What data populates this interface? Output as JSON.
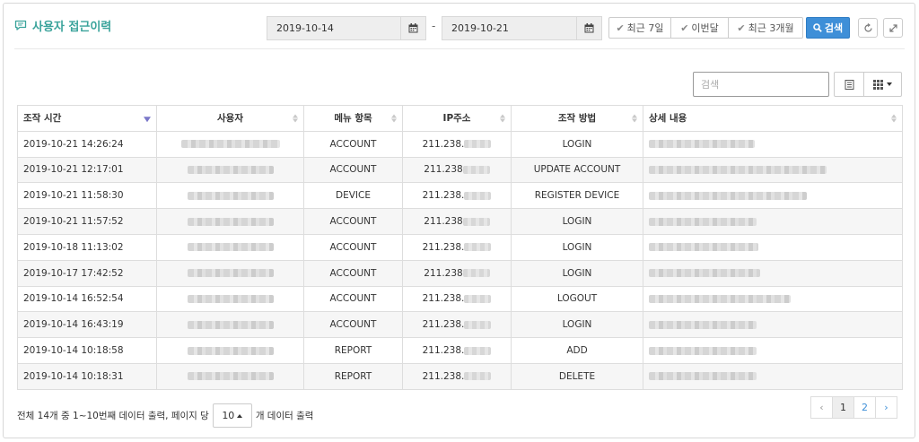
{
  "header": {
    "title": "사용자 접근이력",
    "date_from": "2019-10-14",
    "date_to": "2019-10-21",
    "date_separator": "-",
    "quick_ranges": [
      "최근 7일",
      "이번달",
      "최근 3개월"
    ],
    "search_button": "검색"
  },
  "toolbar": {
    "search_placeholder": "검색"
  },
  "table": {
    "columns": [
      "조작 시간",
      "사용자",
      "메뉴 항목",
      "IP주소",
      "조작 방법",
      "상세 내용"
    ],
    "rows": [
      {
        "time": "2019-10-21 14:26:24",
        "menu": "ACCOUNT",
        "ip": "211.238.",
        "action": "LOGIN"
      },
      {
        "time": "2019-10-21 12:17:01",
        "menu": "ACCOUNT",
        "ip": "211.238",
        "action": "UPDATE ACCOUNT"
      },
      {
        "time": "2019-10-21 11:58:30",
        "menu": "DEVICE",
        "ip": "211.238.",
        "action": "REGISTER DEVICE"
      },
      {
        "time": "2019-10-21 11:57:52",
        "menu": "ACCOUNT",
        "ip": "211.238",
        "action": "LOGIN"
      },
      {
        "time": "2019-10-18 11:13:02",
        "menu": "ACCOUNT",
        "ip": "211.238.",
        "action": "LOGIN"
      },
      {
        "time": "2019-10-17 17:42:52",
        "menu": "ACCOUNT",
        "ip": "211.238",
        "action": "LOGIN"
      },
      {
        "time": "2019-10-14 16:52:54",
        "menu": "ACCOUNT",
        "ip": "211.238.",
        "action": "LOGOUT"
      },
      {
        "time": "2019-10-14 16:43:19",
        "menu": "ACCOUNT",
        "ip": "211.238.",
        "action": "LOGIN"
      },
      {
        "time": "2019-10-14 10:18:58",
        "menu": "REPORT",
        "ip": "211.238.",
        "action": "ADD"
      },
      {
        "time": "2019-10-14 10:18:31",
        "menu": "REPORT",
        "ip": "211.238.",
        "action": "DELETE"
      }
    ]
  },
  "footer": {
    "summary": "전체 14개 중 1~10번째 데이터 출력, 페이지 당",
    "page_size": "10",
    "suffix": "개 데이터 출력",
    "pages": [
      "‹",
      "1",
      "2",
      "›"
    ]
  },
  "colors": {
    "title": "#3aa39b",
    "primary_button": "#3e8fd8",
    "sort_active": "#7a77c9"
  }
}
